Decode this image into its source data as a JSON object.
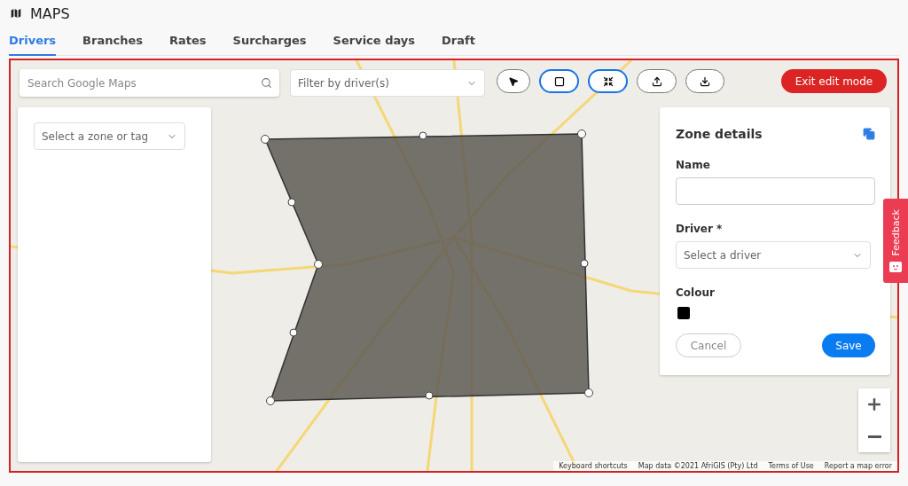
{
  "header": {
    "title": "MAPS"
  },
  "tabs": [
    {
      "label": "Drivers",
      "selected": true
    },
    {
      "label": "Branches",
      "selected": false
    },
    {
      "label": "Rates",
      "selected": false
    },
    {
      "label": "Surcharges",
      "selected": false
    },
    {
      "label": "Service days",
      "selected": false
    },
    {
      "label": "Draft",
      "selected": false
    }
  ],
  "map": {
    "search": {
      "placeholder": "Search Google Maps"
    },
    "filter": {
      "placeholder": "Filter by driver(s)"
    },
    "tools": [
      {
        "kind": "pointer",
        "selected": false
      },
      {
        "kind": "polygon",
        "selected": true
      },
      {
        "kind": "shrink",
        "selected": true
      },
      {
        "kind": "upload",
        "selected": false
      },
      {
        "kind": "download",
        "selected": false
      }
    ],
    "exit_button": "Exit edit mode",
    "zone_select": {
      "placeholder": "Select a zone or tag"
    },
    "attribution": [
      "Keyboard shortcuts",
      "Map data ©2021 AfriGIS (Pty) Ltd",
      "Terms of Use",
      "Report a map error"
    ]
  },
  "zone_details": {
    "title": "Zone details",
    "name_label": "Name",
    "driver_label": "Driver *",
    "driver_placeholder": "Select a driver",
    "colour_label": "Colour",
    "colour": {
      "color": "#000000"
    },
    "cancel": "Cancel",
    "save": "Save"
  },
  "feedback": "Feedback"
}
